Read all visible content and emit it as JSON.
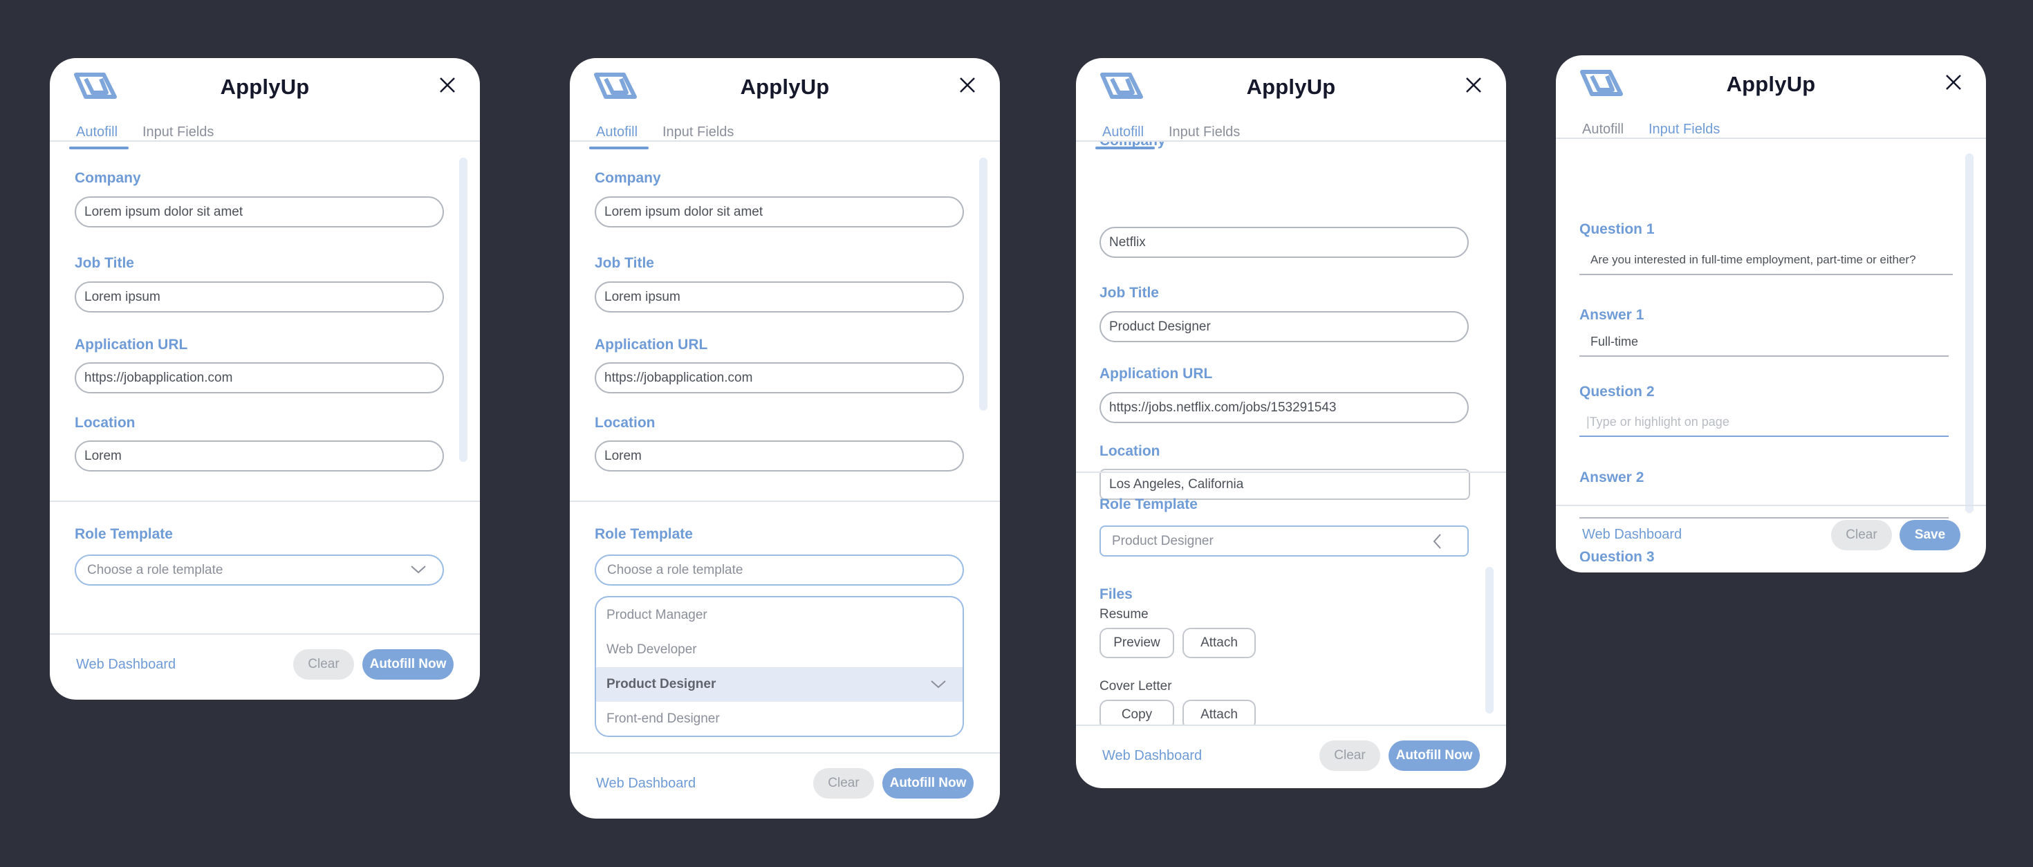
{
  "app": {
    "title": "ApplyUp"
  },
  "tabs": {
    "autofill": "Autofill",
    "input_fields": "Input Fields"
  },
  "footer": {
    "web_dashboard": "Web Dashboard",
    "clear": "Clear",
    "autofill_now": "Autofill Now",
    "save": "Save"
  },
  "labels": {
    "company": "Company",
    "job_title": "Job Title",
    "application_url": "Application URL",
    "location": "Location",
    "role_template": "Role Template",
    "files": "Files",
    "resume": "Resume",
    "cover_letter": "Cover Letter"
  },
  "panel1": {
    "company": "Lorem ipsum dolor sit amet",
    "job_title": "Lorem ipsum",
    "application_url": "https://jobapplication.com",
    "location": "Lorem",
    "role_template_placeholder": "Choose a role template"
  },
  "panel2": {
    "company": "Lorem ipsum dolor sit amet",
    "job_title": "Lorem ipsum",
    "application_url": "https://jobapplication.com",
    "location": "Lorem",
    "role_template_placeholder": "Choose a role template",
    "options": [
      "Product Manager",
      "Web Developer",
      "Product Designer",
      "Front-end Designer"
    ]
  },
  "panel3": {
    "company": "Netflix",
    "job_title": "Product Designer",
    "application_url": "https://jobs.netflix.com/jobs/153291543",
    "location": "Los Angeles, California",
    "role_template": "Product Designer",
    "resume_preview": "Preview",
    "resume_attach": "Attach",
    "cover_copy": "Copy",
    "cover_attach": "Attach"
  },
  "panel4": {
    "question1_label": "Question 1",
    "question1_value": "Are you interested in full-time employment, part-time or either?",
    "answer1_label": "Answer 1",
    "answer1_value": "Full-time",
    "question2_label": "Question 2",
    "question2_placeholder": "|Type or highlight on page",
    "answer2_label": "Answer 2",
    "answer2_value": "",
    "question3_label": "Question 3"
  },
  "colors": {
    "accent": "#6f9bd6",
    "primary_button": "#7fa6db",
    "background": "#2e313b",
    "title": "#14182a"
  },
  "icons": {
    "logo": "applyup-logo",
    "close": "close-icon",
    "chevron_down": "chevron-down-icon",
    "chevron_left": "chevron-left-icon"
  }
}
